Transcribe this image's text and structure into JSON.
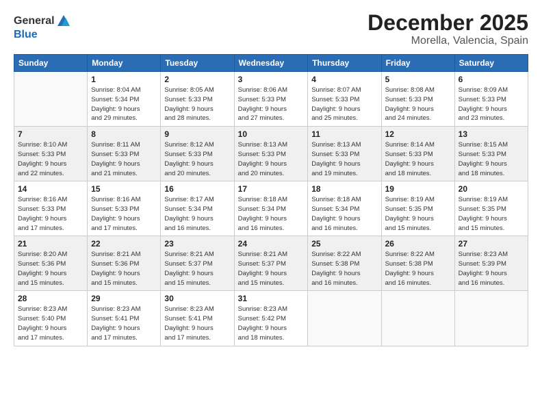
{
  "logo": {
    "general": "General",
    "blue": "Blue"
  },
  "title": "December 2025",
  "subtitle": "Morella, Valencia, Spain",
  "weekdays": [
    "Sunday",
    "Monday",
    "Tuesday",
    "Wednesday",
    "Thursday",
    "Friday",
    "Saturday"
  ],
  "weeks": [
    [
      {
        "day": "",
        "info": ""
      },
      {
        "day": "1",
        "info": "Sunrise: 8:04 AM\nSunset: 5:34 PM\nDaylight: 9 hours\nand 29 minutes."
      },
      {
        "day": "2",
        "info": "Sunrise: 8:05 AM\nSunset: 5:33 PM\nDaylight: 9 hours\nand 28 minutes."
      },
      {
        "day": "3",
        "info": "Sunrise: 8:06 AM\nSunset: 5:33 PM\nDaylight: 9 hours\nand 27 minutes."
      },
      {
        "day": "4",
        "info": "Sunrise: 8:07 AM\nSunset: 5:33 PM\nDaylight: 9 hours\nand 25 minutes."
      },
      {
        "day": "5",
        "info": "Sunrise: 8:08 AM\nSunset: 5:33 PM\nDaylight: 9 hours\nand 24 minutes."
      },
      {
        "day": "6",
        "info": "Sunrise: 8:09 AM\nSunset: 5:33 PM\nDaylight: 9 hours\nand 23 minutes."
      }
    ],
    [
      {
        "day": "7",
        "info": "Sunrise: 8:10 AM\nSunset: 5:33 PM\nDaylight: 9 hours\nand 22 minutes."
      },
      {
        "day": "8",
        "info": "Sunrise: 8:11 AM\nSunset: 5:33 PM\nDaylight: 9 hours\nand 21 minutes."
      },
      {
        "day": "9",
        "info": "Sunrise: 8:12 AM\nSunset: 5:33 PM\nDaylight: 9 hours\nand 20 minutes."
      },
      {
        "day": "10",
        "info": "Sunrise: 8:13 AM\nSunset: 5:33 PM\nDaylight: 9 hours\nand 20 minutes."
      },
      {
        "day": "11",
        "info": "Sunrise: 8:13 AM\nSunset: 5:33 PM\nDaylight: 9 hours\nand 19 minutes."
      },
      {
        "day": "12",
        "info": "Sunrise: 8:14 AM\nSunset: 5:33 PM\nDaylight: 9 hours\nand 18 minutes."
      },
      {
        "day": "13",
        "info": "Sunrise: 8:15 AM\nSunset: 5:33 PM\nDaylight: 9 hours\nand 18 minutes."
      }
    ],
    [
      {
        "day": "14",
        "info": "Sunrise: 8:16 AM\nSunset: 5:33 PM\nDaylight: 9 hours\nand 17 minutes."
      },
      {
        "day": "15",
        "info": "Sunrise: 8:16 AM\nSunset: 5:33 PM\nDaylight: 9 hours\nand 17 minutes."
      },
      {
        "day": "16",
        "info": "Sunrise: 8:17 AM\nSunset: 5:34 PM\nDaylight: 9 hours\nand 16 minutes."
      },
      {
        "day": "17",
        "info": "Sunrise: 8:18 AM\nSunset: 5:34 PM\nDaylight: 9 hours\nand 16 minutes."
      },
      {
        "day": "18",
        "info": "Sunrise: 8:18 AM\nSunset: 5:34 PM\nDaylight: 9 hours\nand 16 minutes."
      },
      {
        "day": "19",
        "info": "Sunrise: 8:19 AM\nSunset: 5:35 PM\nDaylight: 9 hours\nand 15 minutes."
      },
      {
        "day": "20",
        "info": "Sunrise: 8:19 AM\nSunset: 5:35 PM\nDaylight: 9 hours\nand 15 minutes."
      }
    ],
    [
      {
        "day": "21",
        "info": "Sunrise: 8:20 AM\nSunset: 5:36 PM\nDaylight: 9 hours\nand 15 minutes."
      },
      {
        "day": "22",
        "info": "Sunrise: 8:21 AM\nSunset: 5:36 PM\nDaylight: 9 hours\nand 15 minutes."
      },
      {
        "day": "23",
        "info": "Sunrise: 8:21 AM\nSunset: 5:37 PM\nDaylight: 9 hours\nand 15 minutes."
      },
      {
        "day": "24",
        "info": "Sunrise: 8:21 AM\nSunset: 5:37 PM\nDaylight: 9 hours\nand 15 minutes."
      },
      {
        "day": "25",
        "info": "Sunrise: 8:22 AM\nSunset: 5:38 PM\nDaylight: 9 hours\nand 16 minutes."
      },
      {
        "day": "26",
        "info": "Sunrise: 8:22 AM\nSunset: 5:38 PM\nDaylight: 9 hours\nand 16 minutes."
      },
      {
        "day": "27",
        "info": "Sunrise: 8:23 AM\nSunset: 5:39 PM\nDaylight: 9 hours\nand 16 minutes."
      }
    ],
    [
      {
        "day": "28",
        "info": "Sunrise: 8:23 AM\nSunset: 5:40 PM\nDaylight: 9 hours\nand 17 minutes."
      },
      {
        "day": "29",
        "info": "Sunrise: 8:23 AM\nSunset: 5:41 PM\nDaylight: 9 hours\nand 17 minutes."
      },
      {
        "day": "30",
        "info": "Sunrise: 8:23 AM\nSunset: 5:41 PM\nDaylight: 9 hours\nand 17 minutes."
      },
      {
        "day": "31",
        "info": "Sunrise: 8:23 AM\nSunset: 5:42 PM\nDaylight: 9 hours\nand 18 minutes."
      },
      {
        "day": "",
        "info": ""
      },
      {
        "day": "",
        "info": ""
      },
      {
        "day": "",
        "info": ""
      }
    ]
  ]
}
